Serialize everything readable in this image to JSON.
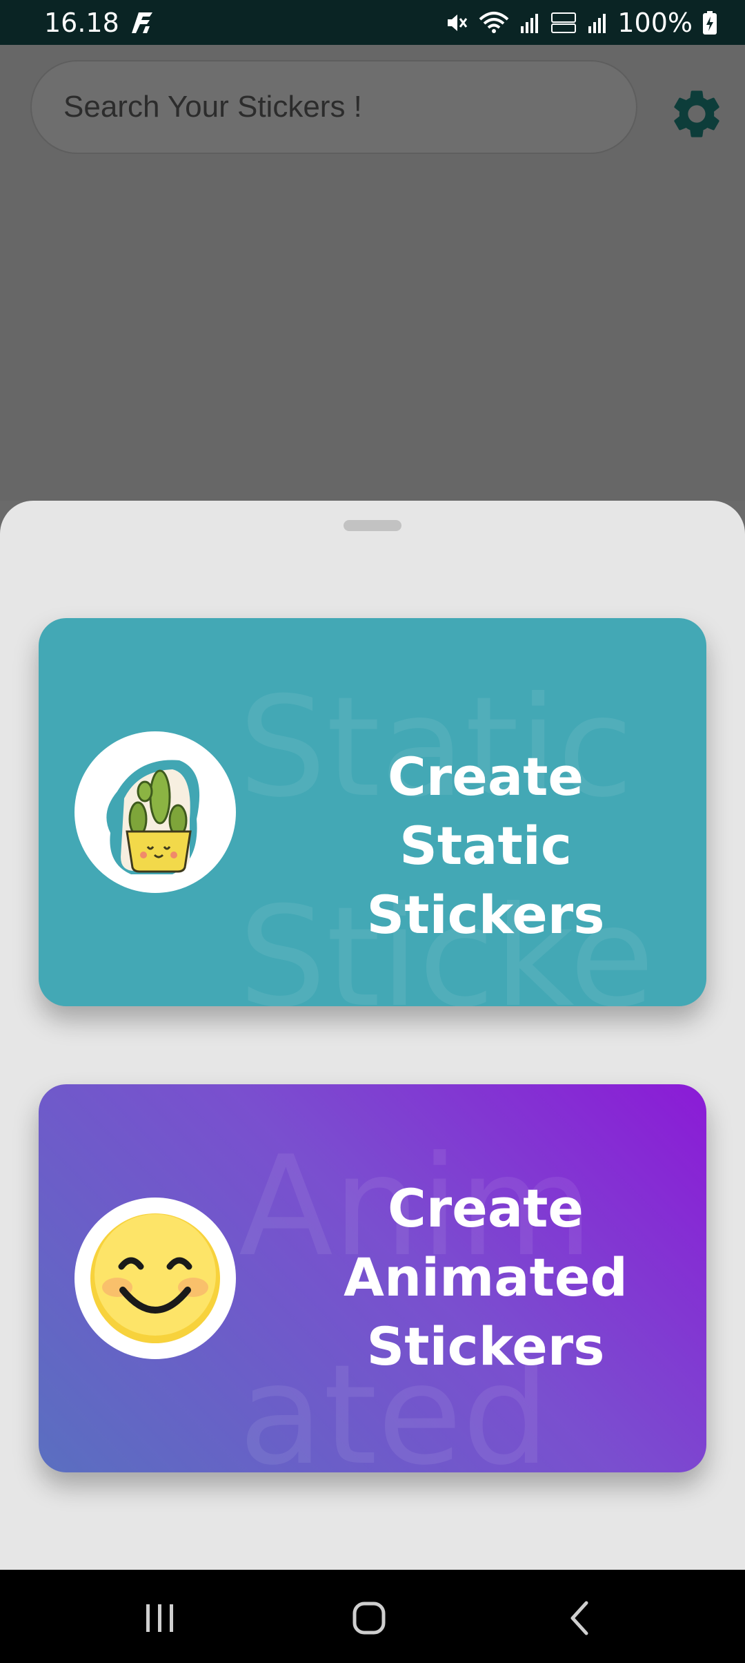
{
  "status_bar": {
    "time": "16.18",
    "battery": "100%"
  },
  "search": {
    "placeholder": "Search Your Stickers !"
  },
  "cards": {
    "static": {
      "title": "Create Static Stickers",
      "watermark_line1": "Static",
      "watermark_line2": "Sticke",
      "icon": "cactus-icon",
      "color": "#43a8b5"
    },
    "animated": {
      "title": "Create Animated Stickers",
      "watermark_line1": "Anim",
      "watermark_line2": "ated",
      "icon": "smiley-icon",
      "gradient": [
        "#5a6fc0",
        "#8b1bd6"
      ]
    }
  },
  "colors": {
    "status_bar": "#0a2424",
    "sheet": "#e6e6e6",
    "settings_icon": "#0d3d3a"
  },
  "icons": {
    "settings": "gear-icon",
    "nav_recents": "recents-icon",
    "nav_home": "home-icon",
    "nav_back": "back-icon"
  }
}
